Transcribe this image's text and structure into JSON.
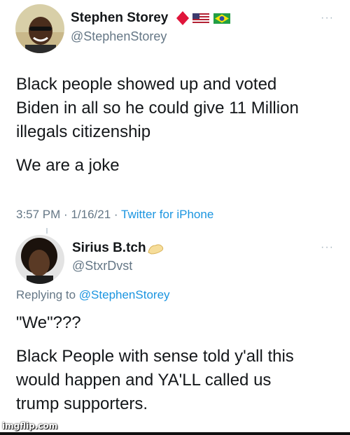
{
  "tweet1": {
    "name": "Stephen Storey",
    "handle": "@StephenStorey",
    "text_line1": "Black people showed up and voted",
    "text_line2": "Biden in all so he could give 11 Million",
    "text_line3": "illegals citizenship",
    "text_line4": "We are a joke",
    "time": "3:57 PM",
    "date": "1/16/21",
    "source": "Twitter for iPhone",
    "sep": "·",
    "more": "···",
    "badges": [
      "red-diamond-icon",
      "us-flag-icon",
      "brazil-flag-icon"
    ]
  },
  "tweet2": {
    "name": "Sirius B.tch",
    "name_icon": "flexed-arm-icon",
    "handle": "@StxrDvst",
    "replying_to_label": "Replying to",
    "replying_to_handle": "@StephenStorey",
    "text_line1": "\"We\"???",
    "text_line2": "Black People with sense told y'all this",
    "text_line3": "would happen and YA'LL called us",
    "text_line4": "trump supporters.",
    "more": "···"
  },
  "watermark": "imgflip.com",
  "colors": {
    "link": "#1b95e0",
    "secondary_text": "#657786",
    "primary_text": "#14171a"
  }
}
